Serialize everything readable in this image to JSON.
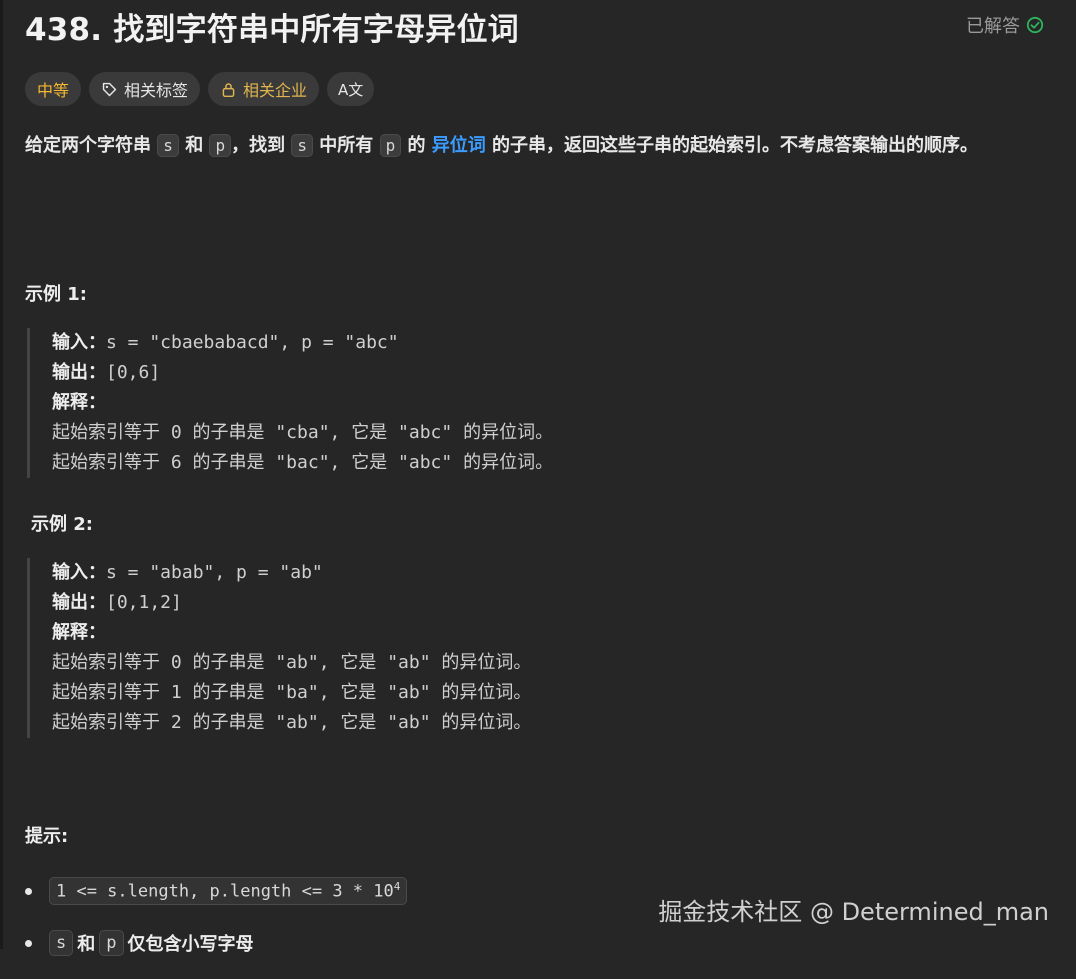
{
  "problem": {
    "title": "438. 找到字符串中所有字母异位词",
    "solved_label": "已解答"
  },
  "tags": {
    "difficulty": "中等",
    "related_topics": "相关标签",
    "related_companies": "相关企业",
    "translate": "A文"
  },
  "description": {
    "t1": "给定两个字符串 ",
    "s": "s",
    "t2": " 和 ",
    "p": "p",
    "t3": "，找到 ",
    "s2": "s",
    "t4": " 中所有 ",
    "p2": "p",
    "t5": " 的 ",
    "link": "异位词",
    "t6": " 的子串，返回这些子串的起始索引。不考虑答案输出的顺序。"
  },
  "examples": [
    {
      "title": "示例 1:",
      "input_label": "输入：",
      "input_value": "s = \"cbaebabacd\", p = \"abc\"",
      "output_label": "输出：",
      "output_value": "[0,6]",
      "explain_label": "解释：",
      "explain_lines": [
        "起始索引等于 0 的子串是 \"cba\", 它是 \"abc\" 的异位词。",
        "起始索引等于 6 的子串是 \"bac\", 它是 \"abc\" 的异位词。"
      ]
    },
    {
      "title": "示例 2:",
      "input_label": "输入：",
      "input_value": "s = \"abab\", p = \"ab\"",
      "output_label": "输出：",
      "output_value": "[0,1,2]",
      "explain_label": "解释：",
      "explain_lines": [
        "起始索引等于 0 的子串是 \"ab\", 它是 \"ab\" 的异位词。",
        "起始索引等于 1 的子串是 \"ba\", 它是 \"ab\" 的异位词。",
        "起始索引等于 2 的子串是 \"ab\", 它是 \"ab\" 的异位词。"
      ]
    }
  ],
  "hints": {
    "title": "提示:",
    "item1_code": "1 <= s.length, p.length <= 3 * 10",
    "item1_sup": "4",
    "item2_s": "s",
    "item2_and": "和",
    "item2_p": "p",
    "item2_text": "仅包含小写字母"
  },
  "watermark": "掘金技术社区 @ Determined_man",
  "colors": {
    "background": "#262626",
    "difficulty_medium": "#f5b731",
    "link": "#3b9cff",
    "solved_check": "#2db55d"
  },
  "icons": [
    "check-circle-icon",
    "tag-icon",
    "lock-icon",
    "translate-icon"
  ]
}
